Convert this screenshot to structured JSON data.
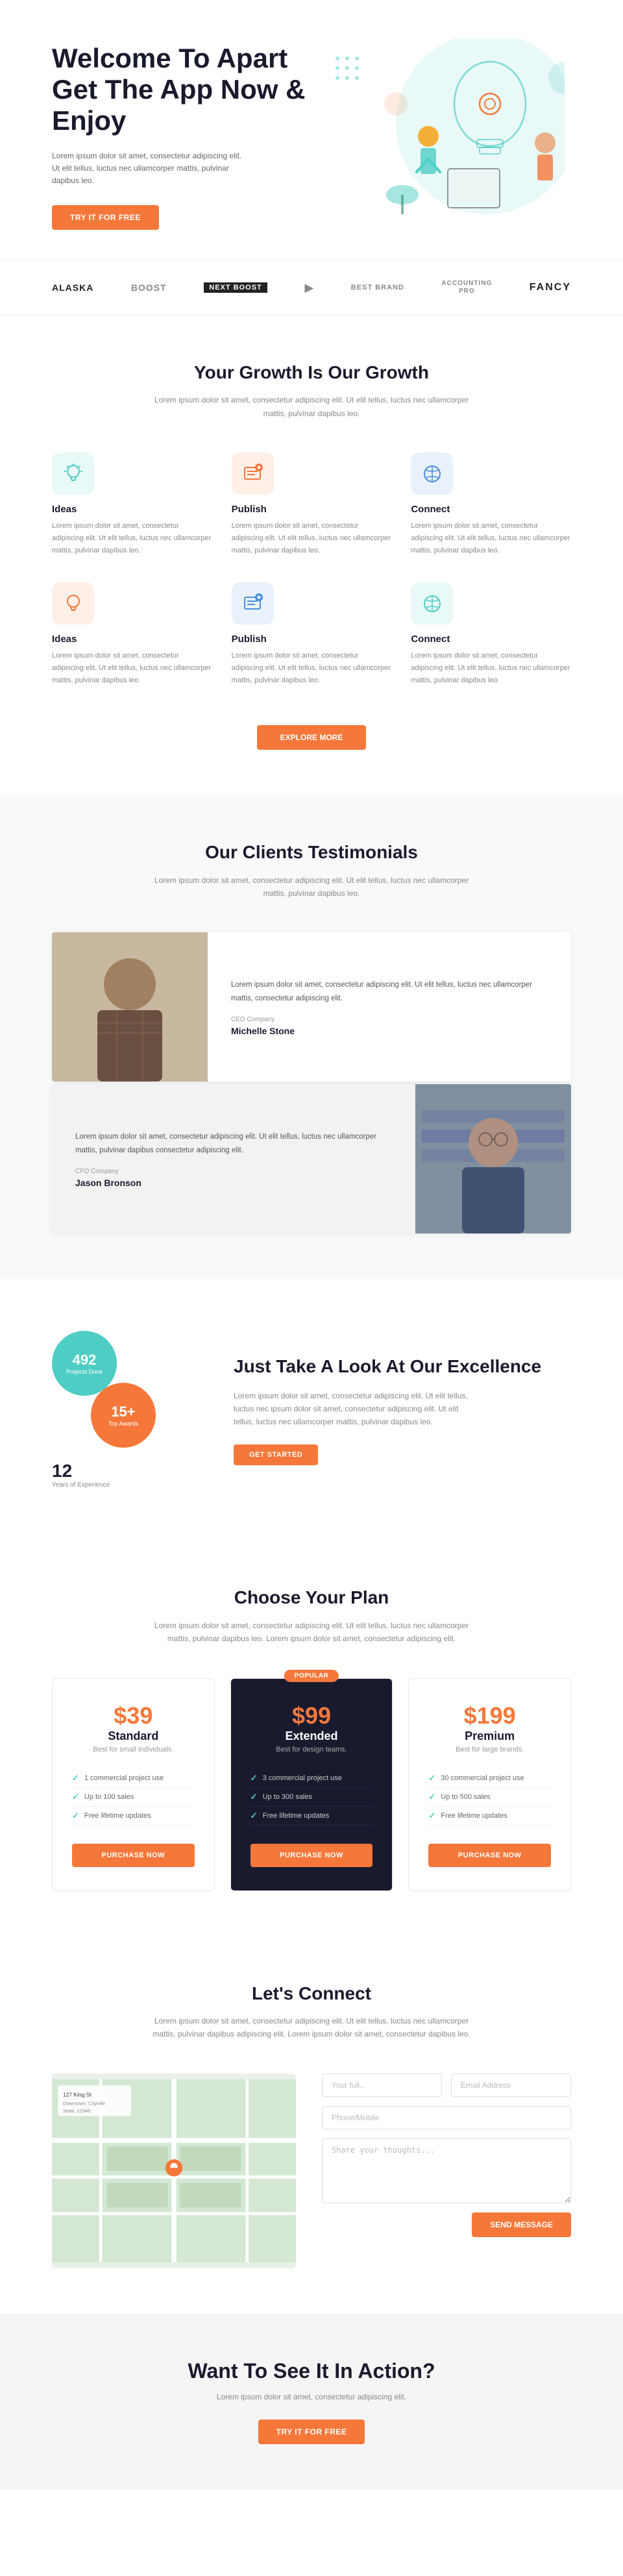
{
  "hero": {
    "title": "Welcome To Apart Get The App Now & Enjoy",
    "description": "Lorem ipsum dolor sit amet, consectetur adipiscing elit. Ut elit tellus, luctus nec ullamcorper mattis, pulvinar dapibus leo.",
    "cta_label": "TRY IT FOR FREE"
  },
  "brands": {
    "items": [
      "ALASKA",
      "BOOST",
      "NEXT BOOST",
      "ACCOUNTING PRO",
      "FANCY"
    ]
  },
  "growth": {
    "title": "Your Growth Is Our Growth",
    "subtitle": "Lorem ipsum dolor sit amet, consectetur adipiscing elit. Ut elit tellus, luctus nec ullamcorper mattis, pulvinar dapibus leo.",
    "features": [
      {
        "icon": "💡",
        "icon_color": "teal",
        "title": "Ideas",
        "text": "Lorem ipsum dolor sit amet, consectetur adipiscing elit. Ut elit tellus, luctus nec ullamcorper mattis, pulvinar dapibus leo."
      },
      {
        "icon": "📢",
        "icon_color": "orange",
        "title": "Publish",
        "text": "Lorem ipsum dolor sit amet, consectetur adipiscing elit. Ut elit tellus, luctus nec ullamcorper mattis, pulvinar dapibus leo."
      },
      {
        "icon": "🔗",
        "icon_color": "blue",
        "title": "Connect",
        "text": "Lorem ipsum dolor sit amet, consectetur adipiscing elit. Ut elit tellus, luctus nec ullamcorper mattis, pulvinar dapibus leo."
      },
      {
        "icon": "💡",
        "icon_color": "orange",
        "title": "Ideas",
        "text": "Lorem ipsum dolor sit amet, consectetur adipiscing elit. Ut elit tellus, luctus nec ullamcorper mattis, pulvinar dapibus leo."
      },
      {
        "icon": "📢",
        "icon_color": "blue",
        "title": "Publish",
        "text": "Lorem ipsum dolor sit amet, consectetur adipiscing elit. Ut elit tellus, luctus nec ullamcorper mattis, pulvinar dapibus leo."
      },
      {
        "icon": "🔗",
        "icon_color": "teal",
        "title": "Connect",
        "text": "Lorem ipsum dolor sit amet, consectetur adipiscing elit. Ut elit tellus, luctus nec ullamcorper mattis, pulvinar dapibus leo."
      }
    ],
    "explore_label": "EXPLORE MORE"
  },
  "testimonials": {
    "title": "Our Clients Testimonials",
    "subtitle": "Lorem ipsum dolor sit amet, consectetur adipiscing elit. Ut elit tellus, luctus nec ullamcorper mattis, pulvinar dapibus leo.",
    "items": [
      {
        "text": "Lorem ipsum dolor sit amet, consectetur adipiscing elit. Ut elit tellus, luctus nec ullamcorper mattis, consectetur adipiscing elit.",
        "role": "CEO Company",
        "name": "Michelle Stone",
        "has_photo_left": false,
        "photo_side": "left"
      },
      {
        "text": "Lorem ipsum dolor sit amet, consectetur adipiscing elit. Ut elit tellus, luctus nec ullamcorper mattis, pulvinar dapibus consectetur adipiscing elit.",
        "role": "CFO Company",
        "name": "Jason Bronson",
        "has_photo_left": true,
        "photo_side": "right"
      }
    ]
  },
  "stats": {
    "title": "Just Take A Look At Our Excellence",
    "description": "Lorem ipsum dolor sit amet, consectetur adipiscing elit. Ut elit tellus, luctus nec ipsum dolor sit amet, consectetur adipiscing elit. Ut elit tellus, luctus nec ullamcorper mattis, pulvinar dapibus leo.",
    "cta_label": "GET STARTED",
    "bubble1_num": "492",
    "bubble1_label": "Projects Done",
    "bubble2_num": "15+",
    "bubble2_label": "Top Awards",
    "stat3_num": "12",
    "stat3_label": "Years of Experience"
  },
  "pricing": {
    "title": "Choose Your Plan",
    "subtitle": "Lorem ipsum dolor sit amet, consectetur adipiscing elit. Ut elit tellus, luctus nec ullamcorper mattis, pulvinar dapibus leo. Lorem ipsum dolor sit amet, consectetur adipiscing elit.",
    "plans": [
      {
        "price": "$39",
        "name": "Standard",
        "desc": "Best for small individuals.",
        "popular": false,
        "features": [
          "1 commercial project use",
          "Up to 100 sales",
          "Free lifetime updates"
        ],
        "cta": "PURCHASE NOW"
      },
      {
        "price": "$99",
        "name": "Extended",
        "desc": "Best for design teams.",
        "popular": true,
        "features": [
          "3 commercial project use",
          "Up to 300 sales",
          "Free lifetime updates"
        ],
        "cta": "PURCHASE NOW",
        "badge": "POPULAR"
      },
      {
        "price": "$199",
        "name": "Premium",
        "desc": "Best for large brands.",
        "popular": false,
        "features": [
          "30 commercial project use",
          "Up to 500 sales",
          "Free lifetime updates"
        ],
        "cta": "PURCHASE NOW"
      }
    ]
  },
  "contact": {
    "title": "Let's Connect",
    "subtitle": "Lorem ipsum dolor sit amet, consectetur adipiscing elit. Ut elit tellus, luctus nec ullamcorper mattis, pulvinar dapibus adipiscing elit. Lorem ipsum dolor sit amet, consectetur dapibus leo.",
    "form": {
      "full_name_placeholder": "Your full...",
      "email_placeholder": "Email Address",
      "phone_placeholder": "Phone/Mobile",
      "message_placeholder": "Share your thoughts...",
      "send_label": "SEND MESSAGE"
    }
  },
  "cta_footer": {
    "title": "Want To See It In Action?",
    "subtitle": "Lorem ipsum dolor sit amet, consectetur adipiscing elit.",
    "cta_label": "TRY IT FOR FREE"
  }
}
